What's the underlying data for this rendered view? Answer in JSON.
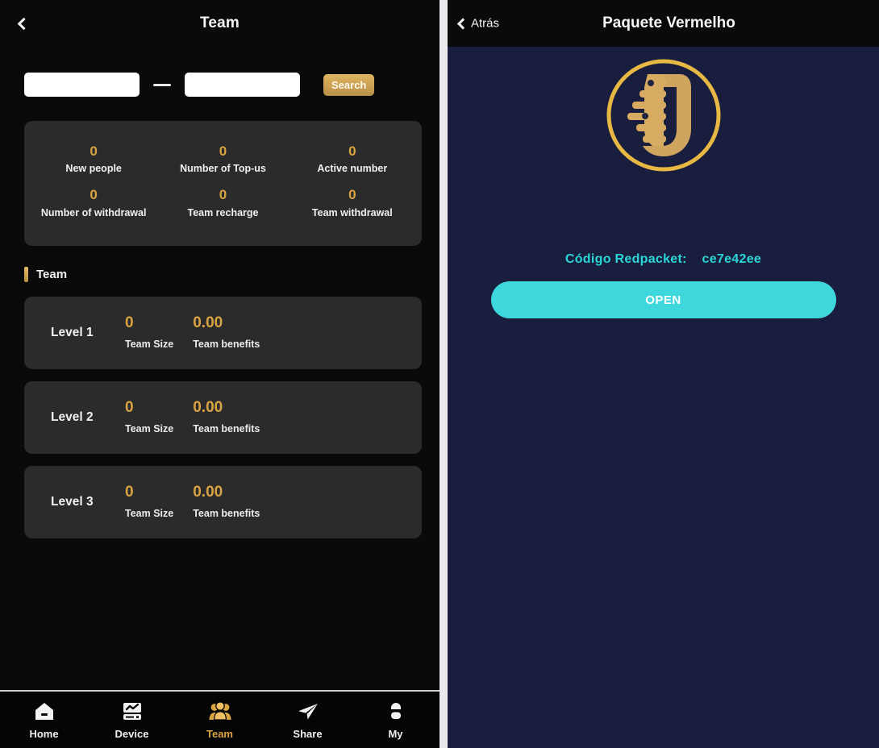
{
  "left": {
    "header": {
      "title": "Team",
      "back_icon": "chevron-left-icon"
    },
    "search": {
      "input_from_value": "",
      "input_from_placeholder": "",
      "separator": "—",
      "input_to_value": "",
      "input_to_placeholder": "",
      "button_label": "Search"
    },
    "stats": [
      {
        "value": "0",
        "label": "New people"
      },
      {
        "value": "0",
        "label": "Number of Top-us"
      },
      {
        "value": "0",
        "label": "Active number"
      },
      {
        "value": "0",
        "label": "Number of withdrawal"
      },
      {
        "value": "0",
        "label": "Team recharge"
      },
      {
        "value": "0",
        "label": "Team withdrawal"
      }
    ],
    "section": {
      "title": "Team"
    },
    "levels": [
      {
        "name": "Level 1",
        "size_value": "0",
        "size_label": "Team Size",
        "benefit_value": "0.00",
        "benefit_label": "Team benefits"
      },
      {
        "name": "Level 2",
        "size_value": "0",
        "size_label": "Team Size",
        "benefit_value": "0.00",
        "benefit_label": "Team benefits"
      },
      {
        "name": "Level 3",
        "size_value": "0",
        "size_label": "Team Size",
        "benefit_value": "0.00",
        "benefit_label": "Team benefits"
      }
    ],
    "nav": [
      {
        "label": "Home",
        "icon": "home-icon",
        "active": false
      },
      {
        "label": "Device",
        "icon": "device-icon",
        "active": false
      },
      {
        "label": "Team",
        "icon": "team-icon",
        "active": true
      },
      {
        "label": "Share",
        "icon": "share-icon",
        "active": false
      },
      {
        "label": "My",
        "icon": "user-icon",
        "active": false
      }
    ]
  },
  "right": {
    "header": {
      "back_label": "Atrás",
      "back_icon": "chevron-left-icon",
      "title": "Paquete Vermelho"
    },
    "logo": {
      "icon": "u-coin-logo-icon"
    },
    "code_label": "Código Redpacket:",
    "code_value": "ce7e42ee",
    "open_button_label": "OPEN"
  },
  "colors": {
    "gold": "#d9a441",
    "cyan": "#2ad6d6",
    "open_button": "#3ed8dc",
    "card": "#2b2b2b",
    "left_bg": "#0a0a0a",
    "right_bg": "#1a1e3e"
  }
}
